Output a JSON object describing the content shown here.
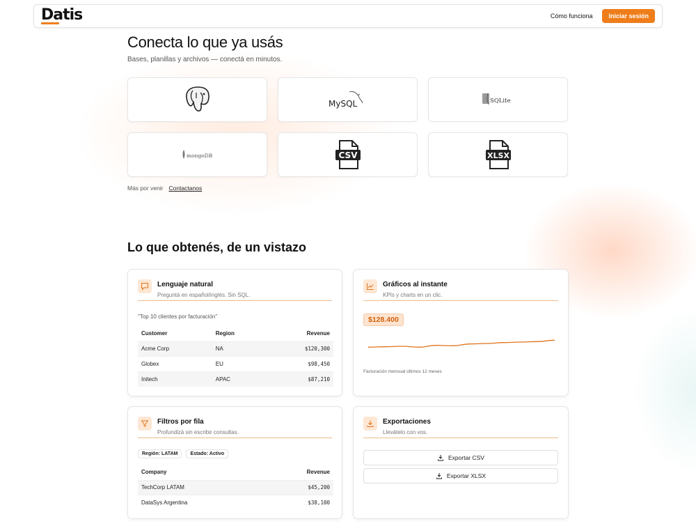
{
  "nav": {
    "logo": "Datis",
    "how_it_works": "Cómo funciona",
    "login": "Iniciar sesión"
  },
  "connect": {
    "title": "Conecta lo que ya usás",
    "subtitle": "Bases, planillas y archivos — conectá en minutos.",
    "sources": [
      {
        "name": "PostgreSQL",
        "icon": "postgresql-icon"
      },
      {
        "name": "MySQL",
        "icon": "mysql-icon",
        "label": "MySQL"
      },
      {
        "name": "SQLite",
        "icon": "sqlite-icon",
        "label": "SQLite"
      },
      {
        "name": "MongoDB",
        "icon": "mongodb-icon",
        "label": "mongoDB"
      },
      {
        "name": "CSV",
        "icon": "csv-file-icon",
        "label": "CSV"
      },
      {
        "name": "XLSX",
        "icon": "xlsx-file-icon",
        "label": "XLSX"
      }
    ],
    "more_text": "Más por venir",
    "contact_link": "Contactanos"
  },
  "features": {
    "title": "Lo que obtenés, de un vistazo",
    "nl": {
      "title": "Lenguaje natural",
      "subtitle": "Preguntá en español/inglés. Sin SQL.",
      "quote": "\"Top 10 clientes por facturación\"",
      "columns": [
        "Customer",
        "Region",
        "Revenue"
      ],
      "rows": [
        [
          "Acme Corp",
          "NA",
          "$120,300"
        ],
        [
          "Globex",
          "EU",
          "$98,450"
        ],
        [
          "Initech",
          "APAC",
          "$87,210"
        ]
      ]
    },
    "charts": {
      "title": "Gráficos al instante",
      "subtitle": "KPIs y charts en un clic.",
      "kpi": "$128.400",
      "caption": "Facturación mensual últimos 12 meses"
    },
    "filters": {
      "title": "Filtros por fila",
      "subtitle": "Profundizá sin escribir consultas.",
      "chips": [
        "Región: LATAM",
        "Estado: Activo"
      ],
      "columns": [
        "Company",
        "Revenue"
      ],
      "rows": [
        [
          "TechCorp LATAM",
          "$45,200"
        ],
        [
          "DataSys Argentina",
          "$38,100"
        ]
      ]
    },
    "exports": {
      "title": "Exportaciones",
      "subtitle": "Llevátelo con vos.",
      "csv": "Exportar CSV",
      "xlsx": "Exportar XLSX"
    }
  },
  "colors": {
    "accent": "#ef7d1a",
    "accent_light": "#fde7d4"
  },
  "chart_data": {
    "type": "line",
    "x": [
      1,
      2,
      3,
      4,
      5,
      6,
      7,
      8,
      9,
      10,
      11,
      12
    ],
    "series": [
      {
        "values": [
          62,
          63,
          64,
          62,
          66,
          65,
          69,
          70,
          72,
          73,
          74,
          77
        ]
      }
    ],
    "ylim": [
      40,
      100
    ],
    "grid": false
  }
}
